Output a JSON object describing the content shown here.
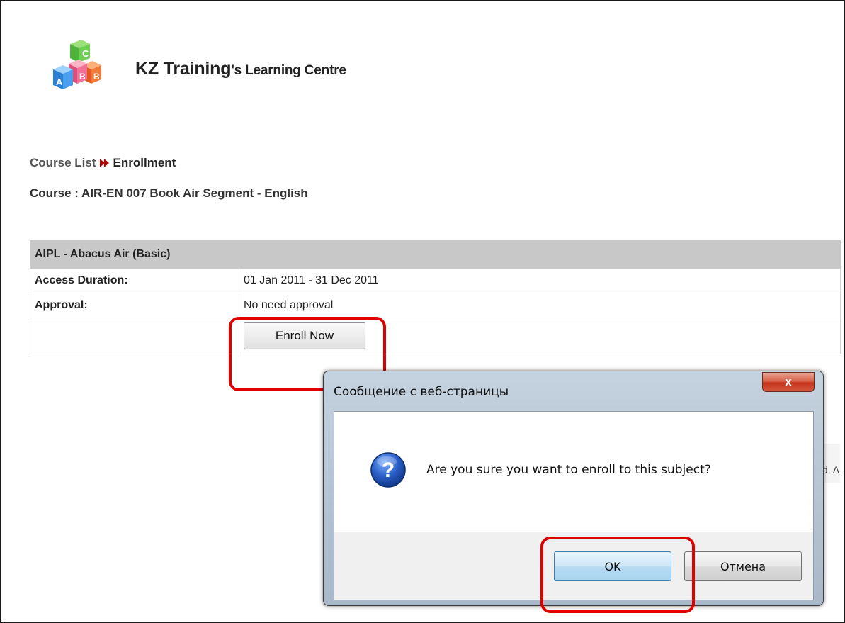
{
  "header": {
    "logo_letters": [
      "A",
      "B",
      "C",
      "B"
    ],
    "title_main": "KZ Training",
    "title_suffix": "'s Learning Centre"
  },
  "breadcrumb": {
    "parent": "Course List",
    "current": "Enrollment",
    "separator_icon": "double-arrow-right-icon"
  },
  "course": {
    "title": "Course : AIR-EN 007 Book Air Segment - English"
  },
  "enrollment_table": {
    "header": "AIPL - Abacus Air (Basic)",
    "rows": [
      {
        "label": "Access Duration:",
        "value": "01 Jan 2011 - 31 Dec 2011"
      },
      {
        "label": "Approval:",
        "value": "No need approval"
      }
    ],
    "enroll_button": "Enroll Now"
  },
  "background_fragment": "d. A",
  "dialog": {
    "title": "Сообщение с веб-страницы",
    "close_label": "x",
    "icon": "question-icon",
    "message": "Are you sure you want to enroll to this subject?",
    "ok_label": "OK",
    "cancel_label": "Отмена"
  },
  "colors": {
    "annotation": "#e00000",
    "table_header": "#c8c8c8",
    "close_button": "#c4331c"
  }
}
